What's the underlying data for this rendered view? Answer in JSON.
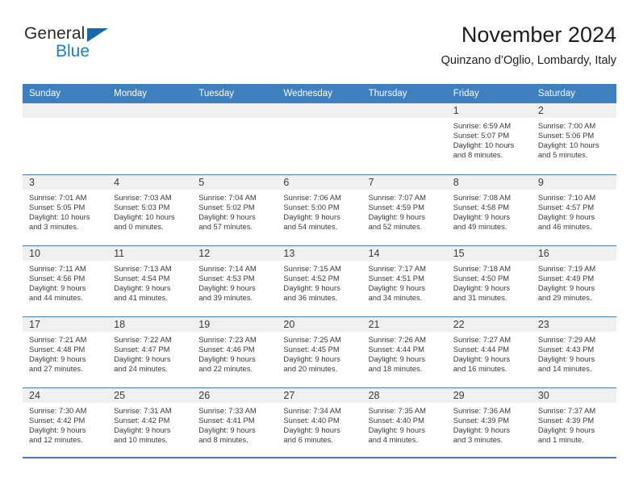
{
  "brand": {
    "name_part1": "General",
    "name_part2": "Blue",
    "triangle_icon": "triangle-icon",
    "accent_color": "#1a7fd4"
  },
  "header": {
    "title": "November 2024",
    "subtitle": "Quinzano d’Oglio, Lombardy, Italy"
  },
  "theme": {
    "header_blue": "#3d7fbf",
    "daynum_band": "#f0f0f0",
    "text": "#3a3a3a"
  },
  "weekdays": [
    "Sunday",
    "Monday",
    "Tuesday",
    "Wednesday",
    "Thursday",
    "Friday",
    "Saturday"
  ],
  "weeks": [
    [
      {
        "day": "",
        "sunrise": "",
        "sunset": "",
        "daylight_1": "",
        "daylight_2": ""
      },
      {
        "day": "",
        "sunrise": "",
        "sunset": "",
        "daylight_1": "",
        "daylight_2": ""
      },
      {
        "day": "",
        "sunrise": "",
        "sunset": "",
        "daylight_1": "",
        "daylight_2": ""
      },
      {
        "day": "",
        "sunrise": "",
        "sunset": "",
        "daylight_1": "",
        "daylight_2": ""
      },
      {
        "day": "",
        "sunrise": "",
        "sunset": "",
        "daylight_1": "",
        "daylight_2": ""
      },
      {
        "day": "1",
        "sunrise": "Sunrise: 6:59 AM",
        "sunset": "Sunset: 5:07 PM",
        "daylight_1": "Daylight: 10 hours",
        "daylight_2": "and 8 minutes."
      },
      {
        "day": "2",
        "sunrise": "Sunrise: 7:00 AM",
        "sunset": "Sunset: 5:06 PM",
        "daylight_1": "Daylight: 10 hours",
        "daylight_2": "and 5 minutes."
      }
    ],
    [
      {
        "day": "3",
        "sunrise": "Sunrise: 7:01 AM",
        "sunset": "Sunset: 5:05 PM",
        "daylight_1": "Daylight: 10 hours",
        "daylight_2": "and 3 minutes."
      },
      {
        "day": "4",
        "sunrise": "Sunrise: 7:03 AM",
        "sunset": "Sunset: 5:03 PM",
        "daylight_1": "Daylight: 10 hours",
        "daylight_2": "and 0 minutes."
      },
      {
        "day": "5",
        "sunrise": "Sunrise: 7:04 AM",
        "sunset": "Sunset: 5:02 PM",
        "daylight_1": "Daylight: 9 hours",
        "daylight_2": "and 57 minutes."
      },
      {
        "day": "6",
        "sunrise": "Sunrise: 7:06 AM",
        "sunset": "Sunset: 5:00 PM",
        "daylight_1": "Daylight: 9 hours",
        "daylight_2": "and 54 minutes."
      },
      {
        "day": "7",
        "sunrise": "Sunrise: 7:07 AM",
        "sunset": "Sunset: 4:59 PM",
        "daylight_1": "Daylight: 9 hours",
        "daylight_2": "and 52 minutes."
      },
      {
        "day": "8",
        "sunrise": "Sunrise: 7:08 AM",
        "sunset": "Sunset: 4:58 PM",
        "daylight_1": "Daylight: 9 hours",
        "daylight_2": "and 49 minutes."
      },
      {
        "day": "9",
        "sunrise": "Sunrise: 7:10 AM",
        "sunset": "Sunset: 4:57 PM",
        "daylight_1": "Daylight: 9 hours",
        "daylight_2": "and 46 minutes."
      }
    ],
    [
      {
        "day": "10",
        "sunrise": "Sunrise: 7:11 AM",
        "sunset": "Sunset: 4:56 PM",
        "daylight_1": "Daylight: 9 hours",
        "daylight_2": "and 44 minutes."
      },
      {
        "day": "11",
        "sunrise": "Sunrise: 7:13 AM",
        "sunset": "Sunset: 4:54 PM",
        "daylight_1": "Daylight: 9 hours",
        "daylight_2": "and 41 minutes."
      },
      {
        "day": "12",
        "sunrise": "Sunrise: 7:14 AM",
        "sunset": "Sunset: 4:53 PM",
        "daylight_1": "Daylight: 9 hours",
        "daylight_2": "and 39 minutes."
      },
      {
        "day": "13",
        "sunrise": "Sunrise: 7:15 AM",
        "sunset": "Sunset: 4:52 PM",
        "daylight_1": "Daylight: 9 hours",
        "daylight_2": "and 36 minutes."
      },
      {
        "day": "14",
        "sunrise": "Sunrise: 7:17 AM",
        "sunset": "Sunset: 4:51 PM",
        "daylight_1": "Daylight: 9 hours",
        "daylight_2": "and 34 minutes."
      },
      {
        "day": "15",
        "sunrise": "Sunrise: 7:18 AM",
        "sunset": "Sunset: 4:50 PM",
        "daylight_1": "Daylight: 9 hours",
        "daylight_2": "and 31 minutes."
      },
      {
        "day": "16",
        "sunrise": "Sunrise: 7:19 AM",
        "sunset": "Sunset: 4:49 PM",
        "daylight_1": "Daylight: 9 hours",
        "daylight_2": "and 29 minutes."
      }
    ],
    [
      {
        "day": "17",
        "sunrise": "Sunrise: 7:21 AM",
        "sunset": "Sunset: 4:48 PM",
        "daylight_1": "Daylight: 9 hours",
        "daylight_2": "and 27 minutes."
      },
      {
        "day": "18",
        "sunrise": "Sunrise: 7:22 AM",
        "sunset": "Sunset: 4:47 PM",
        "daylight_1": "Daylight: 9 hours",
        "daylight_2": "and 24 minutes."
      },
      {
        "day": "19",
        "sunrise": "Sunrise: 7:23 AM",
        "sunset": "Sunset: 4:46 PM",
        "daylight_1": "Daylight: 9 hours",
        "daylight_2": "and 22 minutes."
      },
      {
        "day": "20",
        "sunrise": "Sunrise: 7:25 AM",
        "sunset": "Sunset: 4:45 PM",
        "daylight_1": "Daylight: 9 hours",
        "daylight_2": "and 20 minutes."
      },
      {
        "day": "21",
        "sunrise": "Sunrise: 7:26 AM",
        "sunset": "Sunset: 4:44 PM",
        "daylight_1": "Daylight: 9 hours",
        "daylight_2": "and 18 minutes."
      },
      {
        "day": "22",
        "sunrise": "Sunrise: 7:27 AM",
        "sunset": "Sunset: 4:44 PM",
        "daylight_1": "Daylight: 9 hours",
        "daylight_2": "and 16 minutes."
      },
      {
        "day": "23",
        "sunrise": "Sunrise: 7:29 AM",
        "sunset": "Sunset: 4:43 PM",
        "daylight_1": "Daylight: 9 hours",
        "daylight_2": "and 14 minutes."
      }
    ],
    [
      {
        "day": "24",
        "sunrise": "Sunrise: 7:30 AM",
        "sunset": "Sunset: 4:42 PM",
        "daylight_1": "Daylight: 9 hours",
        "daylight_2": "and 12 minutes."
      },
      {
        "day": "25",
        "sunrise": "Sunrise: 7:31 AM",
        "sunset": "Sunset: 4:42 PM",
        "daylight_1": "Daylight: 9 hours",
        "daylight_2": "and 10 minutes."
      },
      {
        "day": "26",
        "sunrise": "Sunrise: 7:33 AM",
        "sunset": "Sunset: 4:41 PM",
        "daylight_1": "Daylight: 9 hours",
        "daylight_2": "and 8 minutes."
      },
      {
        "day": "27",
        "sunrise": "Sunrise: 7:34 AM",
        "sunset": "Sunset: 4:40 PM",
        "daylight_1": "Daylight: 9 hours",
        "daylight_2": "and 6 minutes."
      },
      {
        "day": "28",
        "sunrise": "Sunrise: 7:35 AM",
        "sunset": "Sunset: 4:40 PM",
        "daylight_1": "Daylight: 9 hours",
        "daylight_2": "and 4 minutes."
      },
      {
        "day": "29",
        "sunrise": "Sunrise: 7:36 AM",
        "sunset": "Sunset: 4:39 PM",
        "daylight_1": "Daylight: 9 hours",
        "daylight_2": "and 3 minutes."
      },
      {
        "day": "30",
        "sunrise": "Sunrise: 7:37 AM",
        "sunset": "Sunset: 4:39 PM",
        "daylight_1": "Daylight: 9 hours",
        "daylight_2": "and 1 minute."
      }
    ]
  ]
}
